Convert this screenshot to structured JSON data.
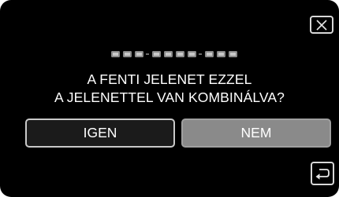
{
  "dialog": {
    "close_icon": "close-icon",
    "placeholder_icon": "redacted-scene-name-dots",
    "message_line1": "A FENTI JELENET EZZEL",
    "message_line2": "A JELENETTEL VAN KOMBINÁLVA?",
    "yes_label": "IGEN",
    "no_label": "NEM",
    "back_icon": "return-arrow-icon"
  },
  "colors": {
    "background": "#000000",
    "text": "#ffffff",
    "button_yes_bg": "#1b1b1b",
    "button_no_bg": "#8a8a8a",
    "border": "#d8d8d8"
  }
}
